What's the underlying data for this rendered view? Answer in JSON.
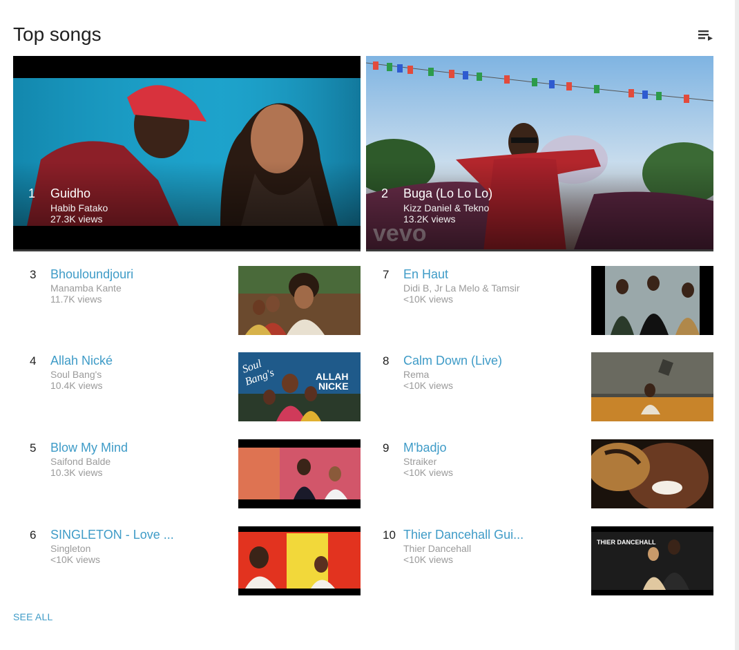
{
  "section": {
    "title": "Top songs",
    "see_all_label": "SEE ALL",
    "play_all_icon": "playlist-play-icon"
  },
  "featured": [
    {
      "rank": "1",
      "title": "Guidho",
      "artist": "Habib Fatako",
      "views": "27.3K views"
    },
    {
      "rank": "2",
      "title": "Buga (Lo Lo Lo)",
      "artist": "Kizz Daniel & Tekno",
      "views": "13.2K views",
      "watermark": "vevo"
    }
  ],
  "songs": [
    {
      "rank": "3",
      "title": "Bhouloundjouri",
      "artist": "Manamba Kante",
      "views": "11.7K views"
    },
    {
      "rank": "4",
      "title": "Allah Nické",
      "artist": "Soul Bang's",
      "views": "10.4K views",
      "thumb_text": [
        "Soul",
        "Bang's",
        "ALLAH",
        "NICKE"
      ]
    },
    {
      "rank": "5",
      "title": "Blow My Mind",
      "artist": "Saifond Balde",
      "views": "10.3K views"
    },
    {
      "rank": "6",
      "title": "SINGLETON - Love ...",
      "artist": "Singleton",
      "views": "<10K views"
    },
    {
      "rank": "7",
      "title": "En Haut",
      "artist": "Didi B, Jr La Melo & Tamsir",
      "views": "<10K views"
    },
    {
      "rank": "8",
      "title": "Calm Down (Live)",
      "artist": "Rema",
      "views": "<10K views"
    },
    {
      "rank": "9",
      "title": "M'badjo",
      "artist": "Straiker",
      "views": "<10K views"
    },
    {
      "rank": "10",
      "title": "Thier Dancehall Gui...",
      "artist": "Thier Dancehall",
      "views": "<10K views",
      "thumb_text": [
        "THIER DANCEHALL"
      ]
    }
  ],
  "colors": {
    "link": "#3e9bc7",
    "meta": "#9a9a9a",
    "title": "#202020"
  }
}
